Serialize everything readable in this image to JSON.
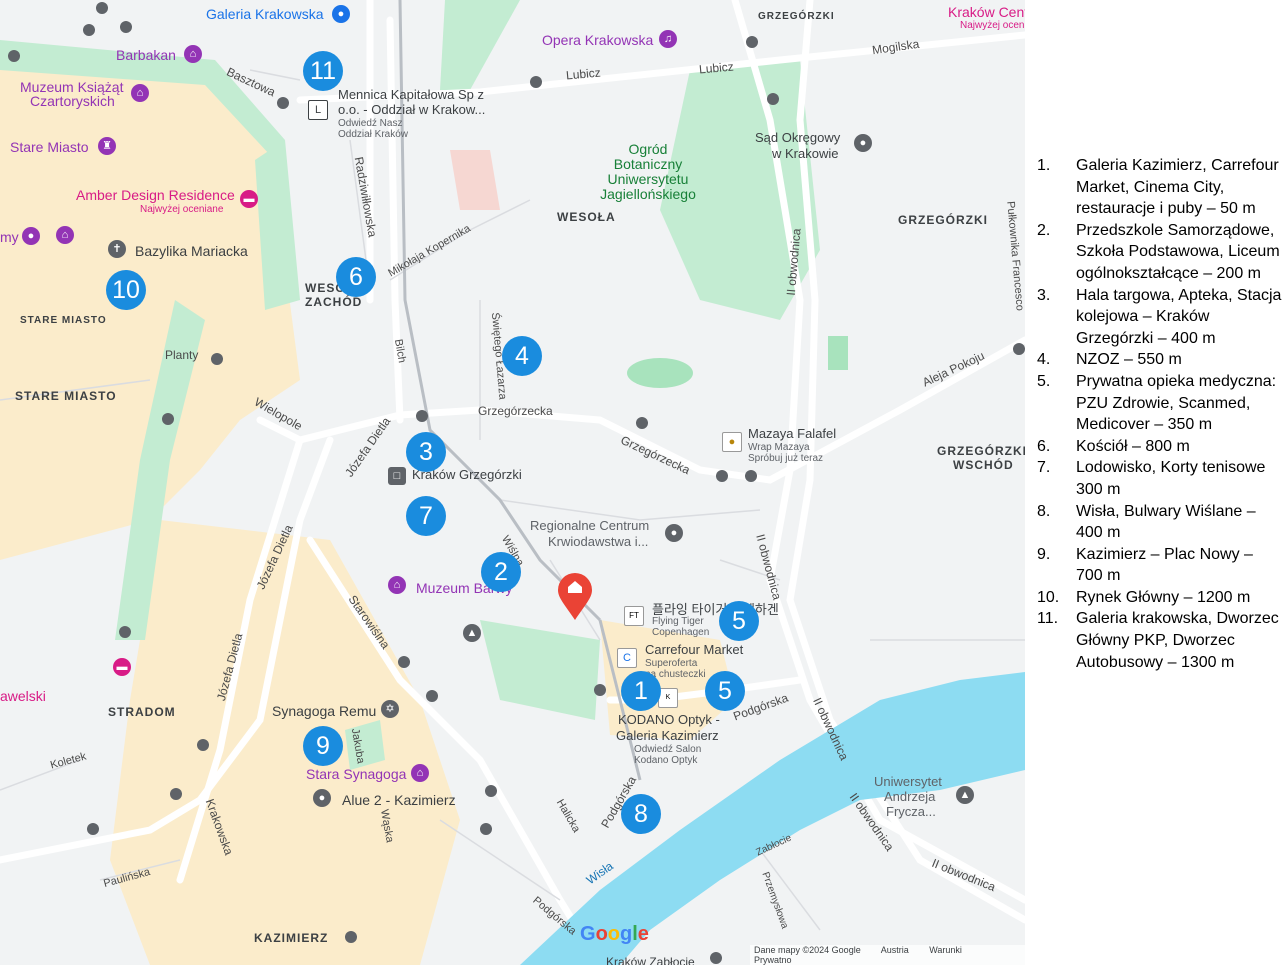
{
  "districts": {
    "wesola": "WESOŁA",
    "wesola_zachod_1": "WESO",
    "wesola_zachod_2": "ZACHÓD",
    "grzegorzki": "GRZEGÓRZKI",
    "grzegorzki_top": "GRZEGÓRZKI",
    "grzegorzki_wschod_1": "GRZEGÓRZKI",
    "grzegorzki_wschod_2": "WSCHÓD",
    "stare_miasto_small": "STARE MIASTO",
    "stare_miasto": "STARE MIASTO",
    "stradom": "STRADOM",
    "kazimierz": "KAZIMIERZ"
  },
  "streets": {
    "lubicz_1": "Lubicz",
    "lubicz_2": "Lubicz",
    "mogilska": "Mogilska",
    "basztowa": "Basztowa",
    "radziwillowska": "Radziwiłłowska",
    "kopernika": "Mikołaja Kopernika",
    "lazarza": "Świętego Łazarza",
    "bilch": "Bilch",
    "grzegorzecka_1": "Grzegórzecka",
    "grzegorzecka_2": "Grzegórzecka",
    "wielopole": "Wielopole",
    "dietla_1": "Józefa Dietla",
    "dietla_2": "Józefa Dietla",
    "dietla_3": "Józefa Dietla",
    "starowislna": "Starowiślna",
    "wislna": "Wiślna",
    "krakowska": "Krakowska",
    "jakuba": "Jakuba",
    "waska": "Wąska",
    "koletek": "Koletek",
    "paulinska": "Paulińska",
    "halicka": "Halicka",
    "podgorska_1": "Podgórska",
    "podgorska_2": "Podgórska",
    "podgorska_3": "Podgórska",
    "obwodnica_1": "II obwodnica",
    "obwodnica_2": "II obwodnica",
    "obwodnica_3": "II obwodnica",
    "obwodnica_4": "II obwodnica",
    "obwodnica_5": "II obwodnica",
    "aleja_pokoju": "Aleja Pokoju",
    "pulkownika": "Pułkownika Francesco",
    "zablocie": "Zabłocie",
    "przemyslowa": "Przemysłowa",
    "wisla": "Wisła",
    "planty": "Planty"
  },
  "pois": {
    "galeria_krakowska": "Galeria Krakowska",
    "krakow_cent": "Kraków Cent",
    "krakow_cent_sub": "Najwyżej ocen",
    "barbakan": "Barbakan",
    "opera": "Opera Krakowska",
    "muzeum_czart_1": "Muzeum Książąt",
    "muzeum_czart_2": "Czartoryskich",
    "stare_miasto_poi": "Stare Miasto",
    "mennica_1": "Mennica Kapitałowa Sp z",
    "mennica_2": "o.o. - Oddział w Krakow...",
    "mennica_sub_1": "Odwiedź Nasz",
    "mennica_sub_2": "Oddział Kraków",
    "ogrod_1": "Ogród",
    "ogrod_2": "Botaniczny",
    "ogrod_3": "Uniwersytetu",
    "ogrod_4": "Jagiellońskiego",
    "sad_1": "Sąd Okręgowy",
    "sad_2": "w Krakowie",
    "amber": "Amber Design Residence",
    "amber_sub": "Najwyżej oceniane",
    "bazylika": "Bazylika Mariacka",
    "my": "my",
    "mazaya": "Mazaya Falafel",
    "mazaya_sub_1": "Wrap Mazaya",
    "mazaya_sub_2": "Spróbuj już teraz",
    "krakow_grzegorzki": "Kraków Grzegórzki",
    "regionalne_1": "Regionalne Centrum",
    "regionalne_2": "Krwiodawstwa i...",
    "muzeum_barwy": "Muzeum Barwy",
    "flying_1": "플라잉 타이거 코펜하겐",
    "flying_2": "Flying Tiger",
    "flying_3": "Copenhagen",
    "carrefour": "Carrefour Market",
    "carrefour_sub_1": "Superoferta",
    "carrefour_sub_2": "na chusteczki",
    "kodano_1": "KODANO Optyk -",
    "kodano_2": "Galeria Kazimierz",
    "kodano_sub_1": "Odwiedź Salon",
    "kodano_sub_2": "Kodano Optyk",
    "synagoga_remu": "Synagoga Remu",
    "stara_synagoga": "Stara Synagoga",
    "alue": "Alue 2 - Kazimierz",
    "wawelski": "awelski",
    "uniwersytet_1": "Uniwersytet",
    "uniwersytet_2": "Andrzeja",
    "uniwersytet_3": "Frycza...",
    "zablocie_station": "Kraków Zabłocie"
  },
  "markers": [
    "1",
    "2",
    "3",
    "4",
    "5",
    "5",
    "6",
    "7",
    "8",
    "9",
    "10",
    "11"
  ],
  "footer": {
    "google": "Google",
    "data": "Dane mapy ©2024 Google",
    "country": "Austria",
    "terms": "Warunki",
    "privacy": "Prywatno"
  },
  "legend": [
    {
      "num": "1.",
      "text": "Galeria Kazimierz, Carrefour Market, Cinema City, restauracje i puby – 50 m"
    },
    {
      "num": "2.",
      "text": "Przedszkole Samorządowe, Szkoła Podstawowa, Liceum ogólnokształcące – 200 m"
    },
    {
      "num": "3.",
      "text": "Hala targowa, Apteka, Stacja kolejowa – Kraków Grzegórzki – 400 m"
    },
    {
      "num": "4.",
      "text": "NZOZ – 550 m"
    },
    {
      "num": "5.",
      "text": "Prywatna opieka medyczna: PZU Zdrowie, Scanmed, Medicover – 350 m"
    },
    {
      "num": "6.",
      "text": "Kościół – 800 m"
    },
    {
      "num": "7.",
      "text": "Lodowisko, Korty tenisowe 300 m"
    },
    {
      "num": "8.",
      "text": "Wisła, Bulwary Wiślane – 400 m"
    },
    {
      "num": "9.",
      "text": "Kazimierz – Plac Nowy – 700 m"
    },
    {
      "num": "10.",
      "text": "Rynek Główny – 1200 m"
    },
    {
      "num": "11.",
      "text": "Galeria krakowska, Dworzec Główny PKP, Dworzec Autobusowy – 1300 m"
    }
  ],
  "colors": {
    "marker": "#1a8cde",
    "river": "#8ddcf2",
    "park": "#c3ecd2",
    "old_town": "#fbeccb",
    "home_pin": "#ea4335"
  }
}
